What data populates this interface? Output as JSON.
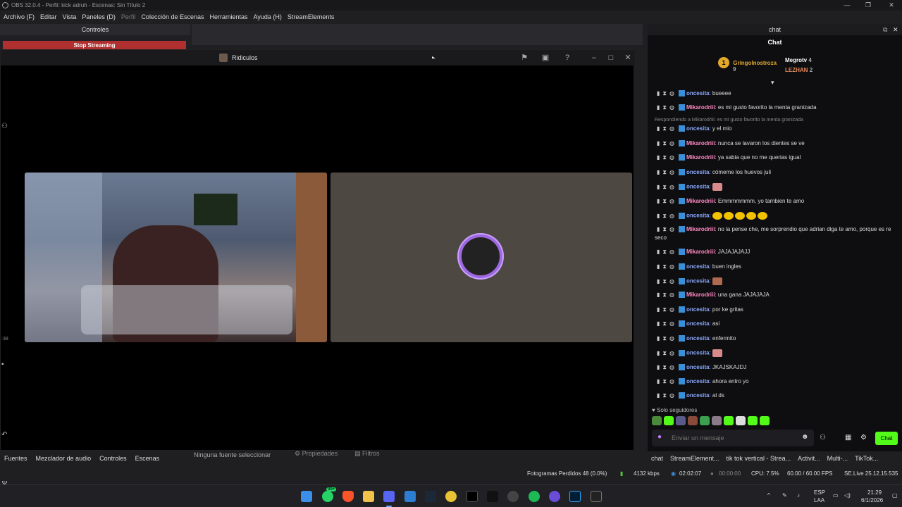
{
  "obs": {
    "title": "OBS 32.0.4 - Perfil: kick adruh - Escenas: Sin Título 2",
    "menu": [
      "Archivo (F)",
      "Editar",
      "Vista",
      "Paneles (D)",
      "Perfil",
      "Colección de Escenas",
      "Herramientas",
      "Ayuda (H)",
      "StreamElements"
    ],
    "controles_title": "Controles",
    "stop_streaming": "Stop Streaming",
    "bottom_tabs": [
      "Fuentes",
      "Mezclador de audio",
      "Controles",
      "Escenas"
    ],
    "no_source": "Ninguna fuente seleccionar",
    "properties": "Propiedades",
    "filters": "Filtros",
    "left_time": ":38"
  },
  "discord": {
    "title": "Ridiculos"
  },
  "chat": {
    "dock_title": "chat",
    "header": "Chat",
    "leaderboard": [
      {
        "rank": "1",
        "name": "Gringolnostroza",
        "count": "9",
        "color": "#e3a92a"
      },
      {
        "name": "Megrotv",
        "count": "4",
        "color": "#ffffff"
      },
      {
        "name": "LEZHAN",
        "count": "2",
        "color": "#e88b5a"
      }
    ],
    "reply_text": "Respondiendo a Mikarodriii: es mi gusto favorito la menta granizada",
    "messages": [
      {
        "user": "oncesita",
        "text": ": bueeee",
        "type": "once"
      },
      {
        "user": "Mikarodriii",
        "text": ": es mi gusto favorito la menta granizada",
        "type": "mika"
      },
      {
        "user": "oncesita",
        "text": ": y el mio",
        "type": "once"
      },
      {
        "user": "Mikarodriii",
        "text": ": nunca se lavaron los dientes se ve",
        "type": "mika"
      },
      {
        "user": "Mikarodriii",
        "text": ": ya sabia que no me querias igual",
        "type": "mika"
      },
      {
        "user": "oncesita",
        "text": ": cómeme los huevos juli",
        "type": "once"
      },
      {
        "user": "oncesita",
        "text": ":",
        "type": "once"
      },
      {
        "user": "Mikarodriii",
        "text": ": Emmmmmmm, yo tambien te amo",
        "type": "mika"
      },
      {
        "user": "oncesita",
        "text": ":",
        "type": "once"
      },
      {
        "user": "Mikarodriii",
        "text": ": no la pense che, me sorprendio que adrian diga te amo, porque es re",
        "type": "mika"
      },
      {
        "user": "Mikarodriii",
        "text": ": JAJAJAJAJJ",
        "type": "mika"
      },
      {
        "user": "oncesita",
        "text": ": buen ingles",
        "type": "once"
      },
      {
        "user": "oncesita",
        "text": ":",
        "type": "once"
      },
      {
        "user": "Mikarodriii",
        "text": ": una gana JAJAJAJA",
        "type": "mika"
      },
      {
        "user": "oncesita",
        "text": ": por ke gritas",
        "type": "once"
      },
      {
        "user": "oncesita",
        "text": ": asi",
        "type": "once"
      },
      {
        "user": "oncesita",
        "text": ": enfermito",
        "type": "once"
      },
      {
        "user": "oncesita",
        "text": ":",
        "type": "once"
      },
      {
        "user": "oncesita",
        "text": ": JKAJSKAJDJ",
        "type": "once"
      },
      {
        "user": "oncesita",
        "text": ": ahora entro yo",
        "type": "once"
      },
      {
        "user": "oncesita",
        "text": ": al ds",
        "type": "once"
      }
    ],
    "wrap_text": "seco",
    "followers_only": "Solo seguidores",
    "input_placeholder": "Enviar un mensaje",
    "send_label": "Chat",
    "dock_tabs": [
      "chat",
      "StreamElement...",
      "tik tok vertical - Strea...",
      "Activit...",
      "Multi-...",
      "TikTok..."
    ]
  },
  "status": {
    "dropped": "Fotogramas Perdidos 48 (0.0%)",
    "kbps": "4132 kbps",
    "stream_time": "02:02:07",
    "rec_time": "00:00:00",
    "cpu": "CPU: 7.5%",
    "fps": "60.00 / 60.00 FPS",
    "version": "SE.Live 25.12.15.535"
  },
  "taskbar": {
    "whatsapp_badge": "99+",
    "lang": "ESP",
    "lang2": "LAA",
    "time": "21:29",
    "date": "6/1/2026"
  }
}
